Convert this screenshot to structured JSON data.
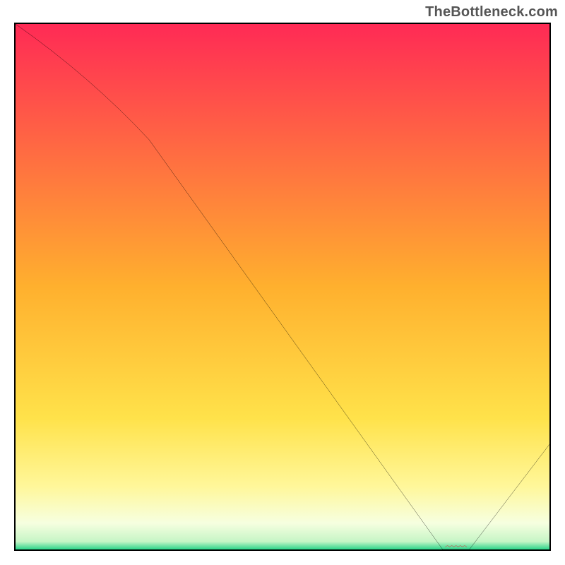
{
  "watermark": "TheBottleneck.com",
  "marker_label": "",
  "chart_data": {
    "type": "line",
    "title": "",
    "xlabel": "",
    "ylabel": "",
    "xlim": [
      0,
      100
    ],
    "ylim": [
      0,
      100
    ],
    "x": [
      0,
      25,
      80,
      85,
      100
    ],
    "values": [
      100,
      78,
      0,
      0,
      20
    ],
    "annotations": [
      {
        "text": "",
        "at_x": 82.5
      }
    ],
    "gradient_stops": [
      {
        "pos": 0.0,
        "color": "#ff2a55"
      },
      {
        "pos": 0.5,
        "color": "#ffb02e"
      },
      {
        "pos": 0.75,
        "color": "#ffe24a"
      },
      {
        "pos": 0.88,
        "color": "#fff79a"
      },
      {
        "pos": 0.95,
        "color": "#f6ffe0"
      },
      {
        "pos": 0.985,
        "color": "#c6f5c6"
      },
      {
        "pos": 1.0,
        "color": "#2bd48a"
      }
    ],
    "series": [
      {
        "name": "curve",
        "x": [
          0,
          25,
          80,
          85,
          100
        ],
        "values": [
          100,
          78,
          0,
          0,
          20
        ]
      }
    ]
  }
}
